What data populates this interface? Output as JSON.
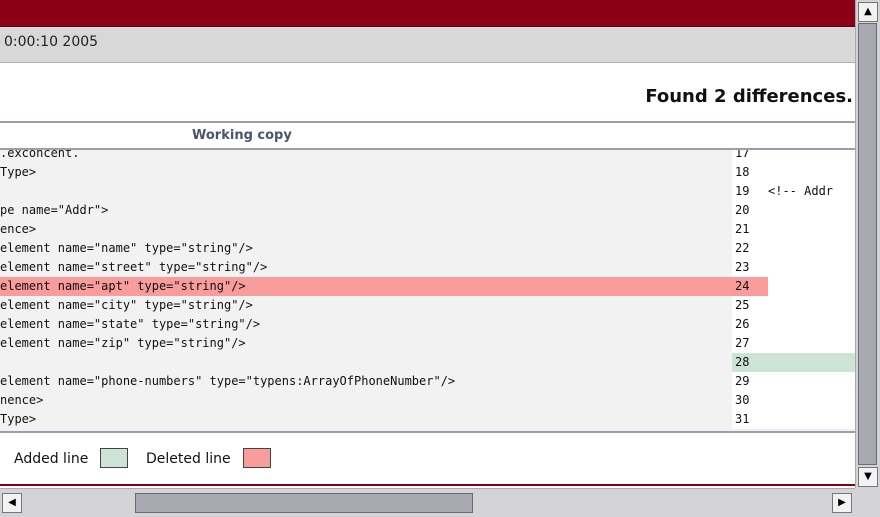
{
  "header": {
    "date_fragment": "0:00:10 2005"
  },
  "summary": {
    "found_text": "Found 2 differences."
  },
  "column": {
    "working_copy_label": "Working copy"
  },
  "lines": [
    {
      "text": ".exconcent.",
      "num": "17",
      "right": "",
      "state": "normal"
    },
    {
      "text": "Type>",
      "num": "18",
      "right": "",
      "state": "normal"
    },
    {
      "text": "",
      "num": "19",
      "right": "<!-- Addr",
      "state": "normal"
    },
    {
      "text": "pe name=\"Addr\">",
      "num": "20",
      "right": "",
      "state": "normal"
    },
    {
      "text": "ence>",
      "num": "21",
      "right": "",
      "state": "normal"
    },
    {
      "text": "element name=\"name\" type=\"string\"/>",
      "num": "22",
      "right": "",
      "state": "normal"
    },
    {
      "text": "element name=\"street\" type=\"string\"/>",
      "num": "23",
      "right": "",
      "state": "normal"
    },
    {
      "text": "element name=\"apt\" type=\"string\"/>",
      "num": "24",
      "right": "",
      "state": "deleted"
    },
    {
      "text": "element name=\"city\" type=\"string\"/>",
      "num": "25",
      "right": "",
      "state": "normal"
    },
    {
      "text": "element name=\"state\" type=\"string\"/>",
      "num": "26",
      "right": "",
      "state": "normal"
    },
    {
      "text": "element name=\"zip\" type=\"string\"/>",
      "num": "27",
      "right": "",
      "state": "normal"
    },
    {
      "text": "",
      "num": "28",
      "right": "",
      "state": "added"
    },
    {
      "text": "element name=\"phone-numbers\" type=\"typens:ArrayOfPhoneNumber\"/>",
      "num": "29",
      "right": "",
      "state": "normal"
    },
    {
      "text": "nence>",
      "num": "30",
      "right": "",
      "state": "normal"
    },
    {
      "text": "Type>",
      "num": "31",
      "right": "",
      "state": "normal"
    }
  ],
  "legend": {
    "added_label": "Added line",
    "deleted_label": "Deleted line"
  },
  "colors": {
    "header_bar": "#8b0015",
    "added": "#cde3d6",
    "deleted": "#f99c9c"
  },
  "scroll_arrows": {
    "up": "▲",
    "down": "▼",
    "left": "◀",
    "right": "▶"
  }
}
